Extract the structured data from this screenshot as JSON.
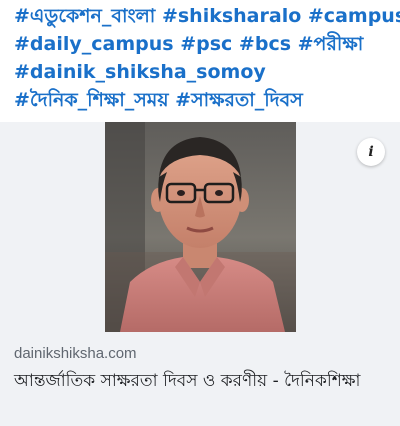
{
  "post": {
    "hashtag_lines": [
      [
        "#এডুকেশন_বাংলা",
        "#shiksharalo",
        "#campus"
      ],
      [
        "#daily_campus",
        "#psc",
        "#bcs",
        "#পরীক্ষা"
      ],
      [
        "#dainik_shiksha_somoy"
      ],
      [
        "#দৈনিক_শিক্ষা_সময়",
        "#সাক্ষরতা_দিবস"
      ]
    ],
    "hashtag_color": "#1a70c9"
  },
  "link_preview": {
    "domain": "dainikshiksha.com",
    "title": "আন্তর্জাতিক সাক্ষরতা দিবস ও করণীয় - দৈনিকশিক্ষা",
    "info_icon": "i",
    "card_background": "#f0f2f5"
  }
}
